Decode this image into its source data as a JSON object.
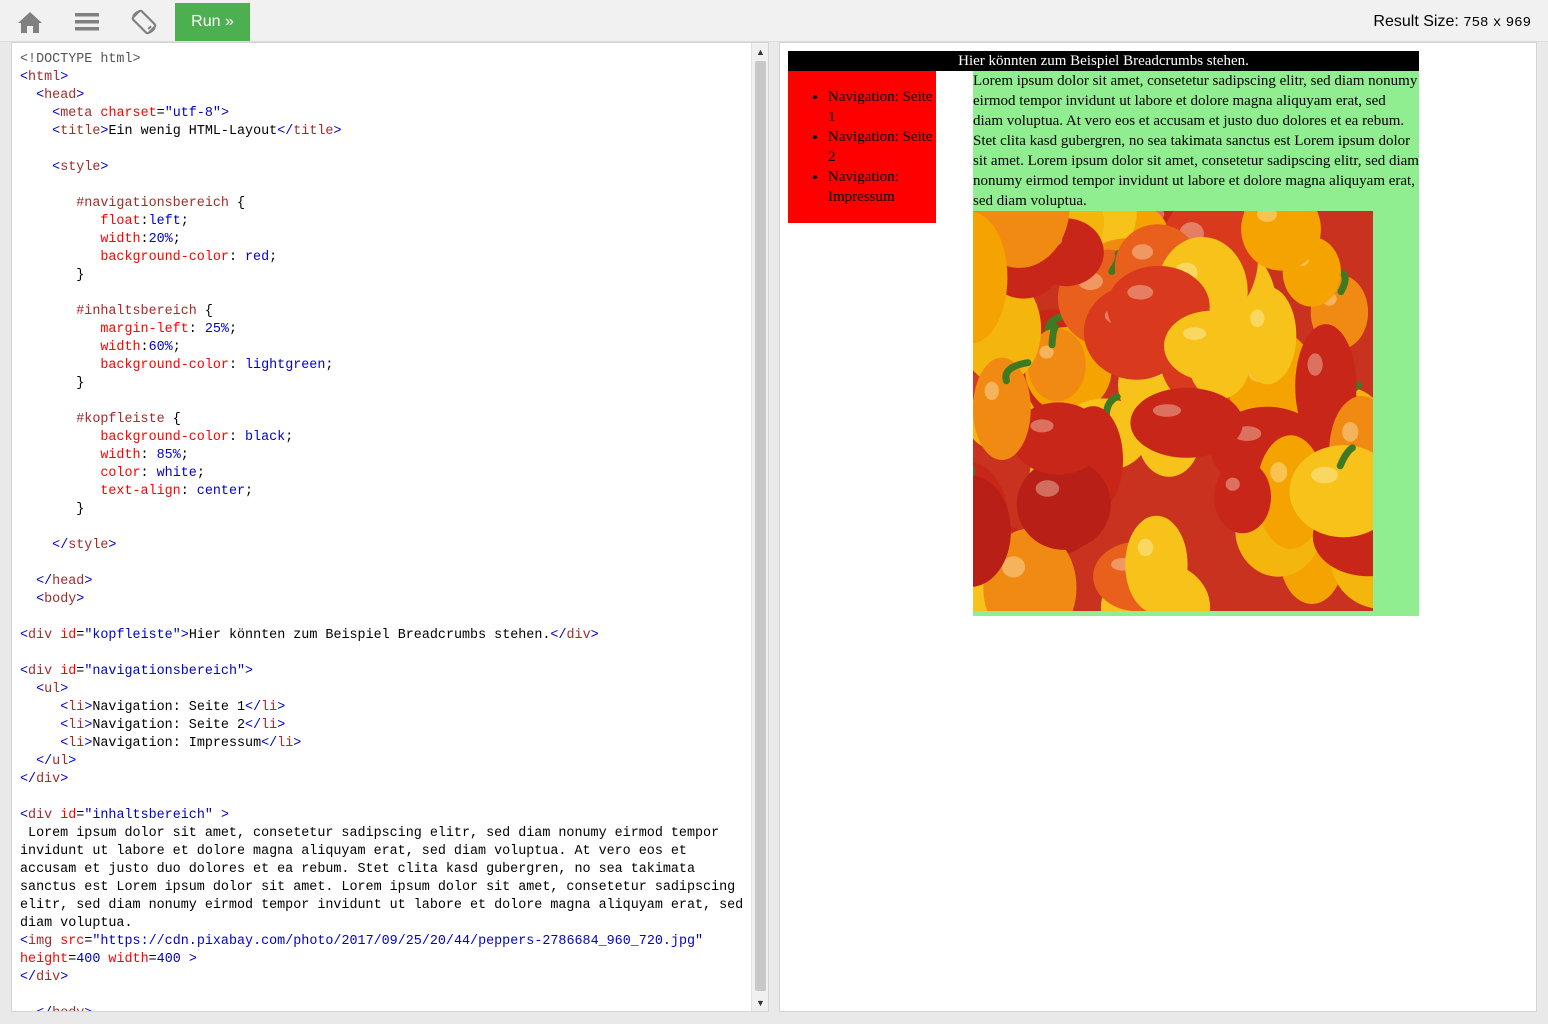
{
  "toolbar": {
    "home_icon": "home-icon",
    "menu_icon": "menu-icon",
    "rotate_icon": "rotate-icon",
    "run_label": "Run »",
    "result_size_label": "Result Size:",
    "result_width": "758",
    "result_x": "x",
    "result_height": "969"
  },
  "code_lines": [
    "<!DOCTYPE html>",
    "<html>",
    "  <head>",
    "    <meta charset=\"utf-8\">",
    "    <title>Ein wenig HTML-Layout</title>",
    "",
    "    <style>",
    "",
    "       #navigationsbereich {",
    "          float:left;",
    "          width:20%;",
    "          background-color: red;",
    "       }",
    "",
    "       #inhaltsbereich {",
    "          margin-left: 25%;",
    "          width:60%;",
    "          background-color: lightgreen;",
    "       }",
    "",
    "       #kopfleiste {",
    "          background-color: black;",
    "          width: 85%;",
    "          color: white;",
    "          text-align: center;",
    "       }",
    "",
    "    </style>",
    "",
    "  </head>",
    "  <body>",
    "",
    "<div id=\"kopfleiste\">Hier könnten zum Beispiel Breadcrumbs stehen.</div>",
    "",
    "<div id=\"navigationsbereich\">",
    "  <ul>",
    "     <li>Navigation: Seite 1</li>",
    "     <li>Navigation: Seite 2</li>",
    "     <li>Navigation: Impressum</li>",
    "  </ul>",
    "</div>",
    "",
    "<div id=\"inhaltsbereich\" >",
    " Lorem ipsum dolor sit amet, consetetur sadipscing elitr, sed diam nonumy eirmod tempor",
    "invidunt ut labore et dolore magna aliquyam erat, sed diam voluptua. At vero eos et",
    "accusam et justo duo dolores et ea rebum. Stet clita kasd gubergren, no sea takimata",
    "sanctus est Lorem ipsum dolor sit amet. Lorem ipsum dolor sit amet, consetetur sadipscing",
    "elitr, sed diam nonumy eirmod tempor invidunt ut labore et dolore magna aliquyam erat, sed",
    "diam voluptua.",
    "<img src=\"https://cdn.pixabay.com/photo/2017/09/25/20/44/peppers-2786684_960_720.jpg\"",
    "height=400 width=400 >",
    "</div>",
    "",
    "  </body>"
  ],
  "result": {
    "kopfleiste": "Hier könnten zum Beispiel Breadcrumbs stehen.",
    "nav_items": [
      "Navigation: Seite 1",
      "Navigation: Seite 2",
      "Navigation: Impressum"
    ],
    "content_text": "Lorem ipsum dolor sit amet, consetetur sadipscing elitr, sed diam nonumy eirmod tempor invidunt ut labore et dolore magna aliquyam erat, sed diam voluptua. At vero eos et accusam et justo duo dolores et ea rebum. Stet clita kasd gubergren, no sea takimata sanctus est Lorem ipsum dolor sit amet. Lorem ipsum dolor sit amet, consetetur sadipscing elitr, sed diam nonumy eirmod tempor invidunt ut labore et dolore magna aliquyam erat, sed diam voluptua.",
    "image_subject": "peppers-photo"
  },
  "colors": {
    "run_button": "#4caf50",
    "kopfleiste_bg": "#000000",
    "nav_bg": "#ff0000",
    "content_bg": "lightgreen"
  }
}
